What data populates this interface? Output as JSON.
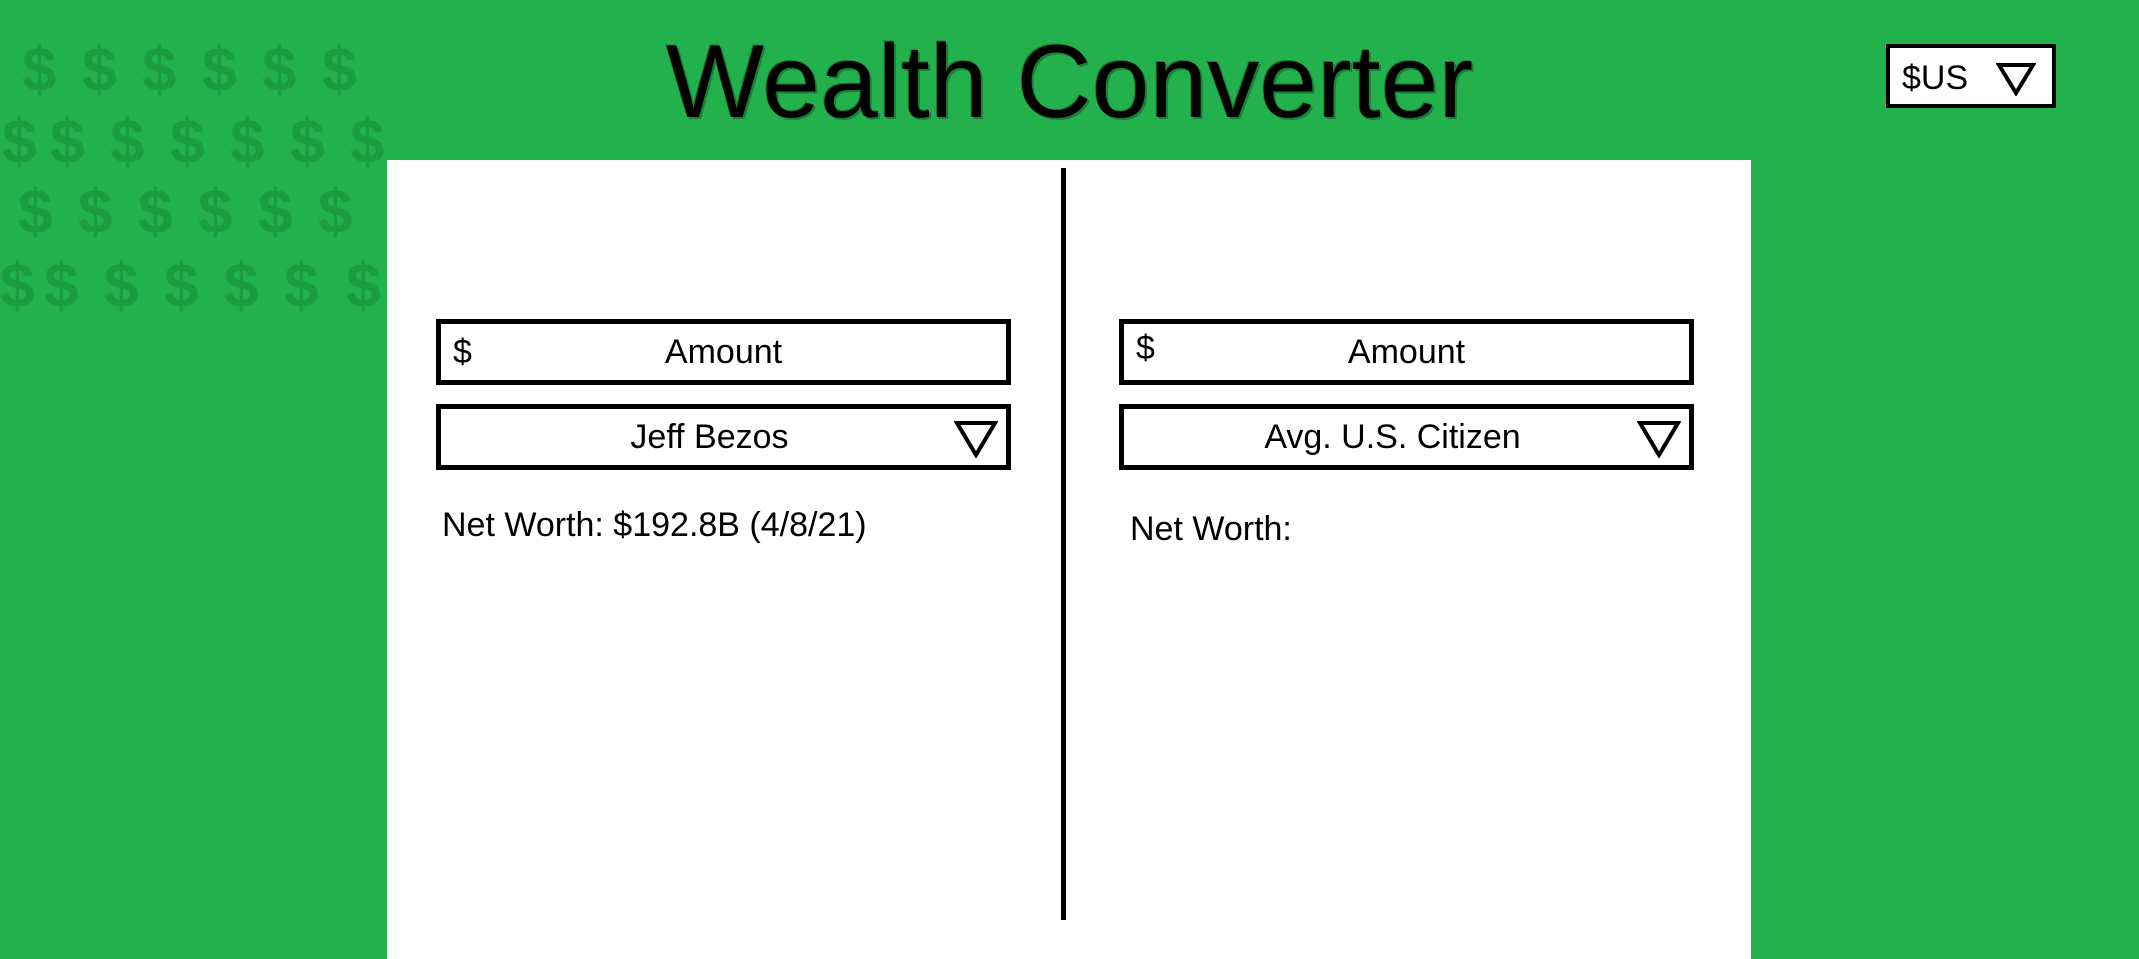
{
  "header": {
    "title": "Wealth Converter",
    "currency_select": {
      "selected": "$US",
      "icon": "triangle-down-icon"
    }
  },
  "background": {
    "pattern_glyph": "$",
    "pattern_color": "#1b9c41"
  },
  "left": {
    "amount": {
      "symbol": "$",
      "placeholder": "Amount"
    },
    "person_select": {
      "selected": "Jeff Bezos",
      "icon": "triangle-down-icon"
    },
    "net_worth": "Net Worth: $192.8B (4/8/21)"
  },
  "right": {
    "amount": {
      "symbol": "$",
      "placeholder": "Amount"
    },
    "person_select": {
      "selected": "Avg. U.S. Citizen",
      "icon": "triangle-down-icon"
    },
    "net_worth": "Net Worth:"
  },
  "colors": {
    "background": "#22b14c",
    "panel": "#ffffff",
    "border": "#000000"
  }
}
